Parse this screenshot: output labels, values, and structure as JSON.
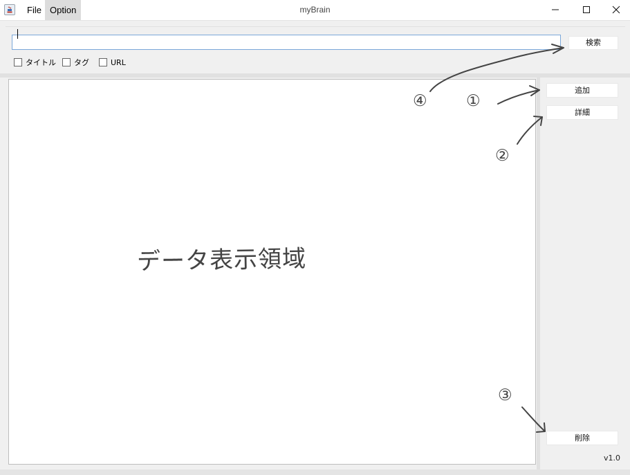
{
  "window": {
    "title": "myBrain",
    "menu": [
      "File",
      "Option"
    ],
    "icons": [
      "app-icon",
      "minimize-icon",
      "maximize-icon",
      "close-icon"
    ]
  },
  "search": {
    "value": "",
    "button_label": "検索",
    "checkboxes": [
      {
        "label": "タイトル",
        "checked": false
      },
      {
        "label": "タグ",
        "checked": false
      },
      {
        "label": "URL",
        "checked": false
      }
    ]
  },
  "sidebar": {
    "add_label": "追加",
    "detail_label": "詳細",
    "delete_label": "削除",
    "version": "v1.0"
  },
  "annotations": {
    "display_area_label": "データ表示領域",
    "markers": [
      "①",
      "②",
      "③",
      "④"
    ]
  },
  "colors": {
    "input_focus_border": "#7aa7d9",
    "annotation_ink": "#444444"
  }
}
